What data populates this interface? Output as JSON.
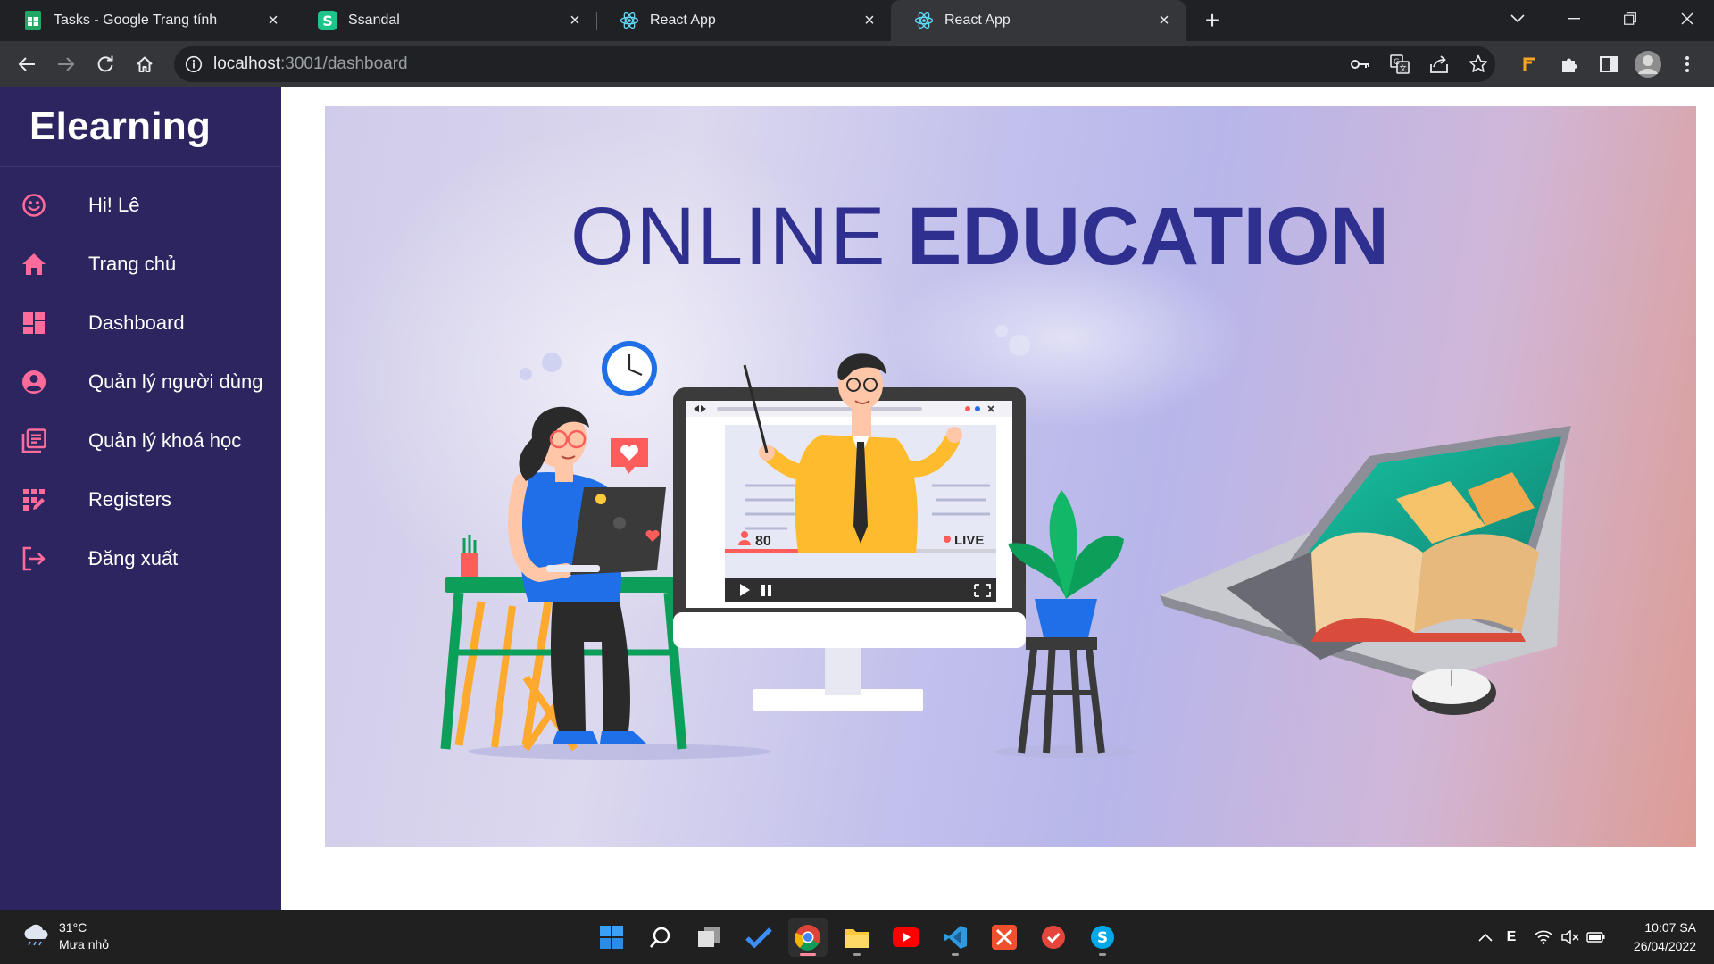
{
  "browser": {
    "tabs": [
      {
        "title": "Tasks - Google Trang tính",
        "favicon": "sheets-icon",
        "active": false
      },
      {
        "title": "Ssandal",
        "favicon": "ssandal-s-icon",
        "active": false
      },
      {
        "title": "React App",
        "favicon": "react-icon",
        "active": false
      },
      {
        "title": "React App",
        "favicon": "react-icon",
        "active": true
      }
    ],
    "url_host": "localhost",
    "url_rest": ":3001/dashboard"
  },
  "sidebar": {
    "brand": "Elearning",
    "items": [
      {
        "label": "Hi! Lê",
        "icon": "smiley-icon"
      },
      {
        "label": "Trang chủ",
        "icon": "home-icon"
      },
      {
        "label": "Dashboard",
        "icon": "dashboard-icon"
      },
      {
        "label": "Quản lý người dùng",
        "icon": "user-circle-icon"
      },
      {
        "label": "Quản lý khoá học",
        "icon": "library-books-icon"
      },
      {
        "label": "Registers",
        "icon": "app-registration-icon"
      },
      {
        "label": "Đăng xuất",
        "icon": "logout-icon"
      }
    ],
    "icon_color": "#ff6b9a",
    "bg_color": "#2c2560"
  },
  "banner": {
    "title_light": "ONLINE",
    "title_bold": "EDUCATION",
    "viewer_count": "80",
    "live_label": "LIVE",
    "title_color": "#2e2f8e"
  },
  "taskbar": {
    "temperature": "31°C",
    "weather": "Mưa nhỏ",
    "input_lang": "E",
    "time": "10:07 SA",
    "date": "26/04/2022"
  }
}
